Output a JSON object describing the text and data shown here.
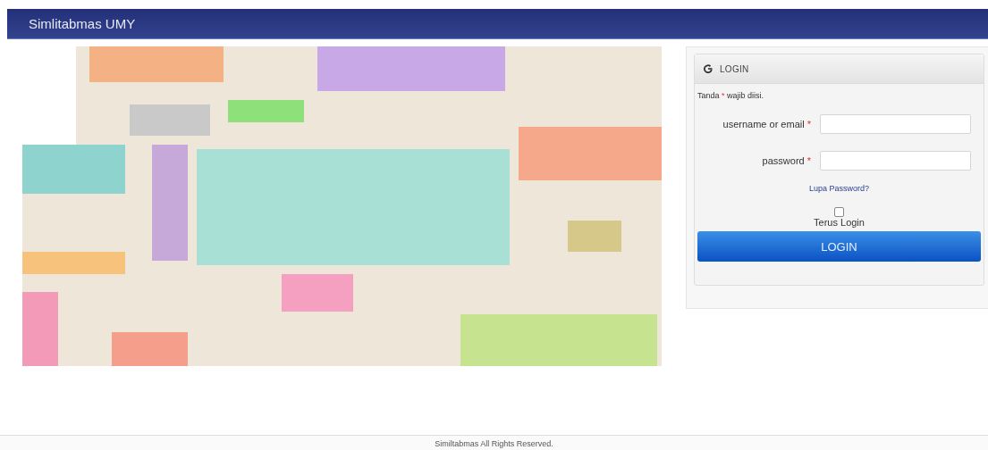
{
  "header": {
    "title": "Simlitabmas UMY"
  },
  "login": {
    "title": "LOGIN",
    "note": {
      "before": "Tanda",
      "mark": "*",
      "after": "wajib diisi."
    },
    "fields": [
      {
        "label": "username or email",
        "mark": "*"
      },
      {
        "label": "password",
        "mark": "*"
      }
    ],
    "forgot_link": "Lupa Password?",
    "remember": {
      "label": "Terus Login",
      "checked": false
    },
    "button": "LOGIN"
  },
  "footer": {
    "text": "Similtabmas All Rights Reserved."
  }
}
